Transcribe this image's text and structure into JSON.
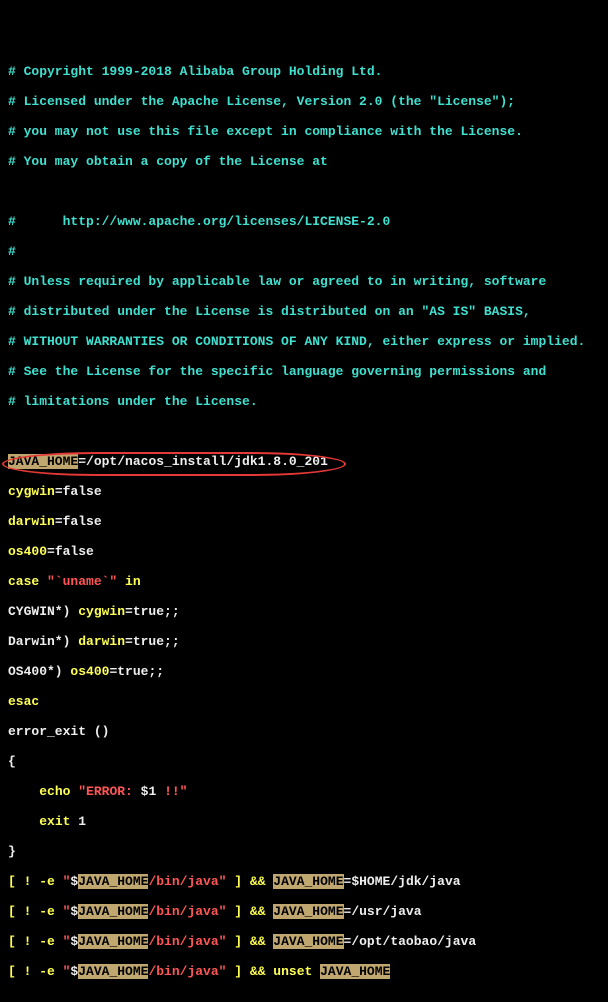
{
  "license": {
    "l1": "# Copyright 1999-2018 Alibaba Group Holding Ltd.",
    "l2": "# Licensed under the Apache License, Version 2.0 (the \"License\");",
    "l3": "# you may not use this file except in compliance with the License.",
    "l4": "# You may obtain a copy of the License at",
    "l5": "#      http://www.apache.org/licenses/LICENSE-2.0",
    "l6": "#",
    "l7": "# Unless required by applicable law or agreed to in writing, software",
    "l8": "# distributed under the License is distributed on an \"AS IS\" BASIS,",
    "l9": "# WITHOUT WARRANTIES OR CONDITIONS OF ANY KIND, either express or implied.",
    "l10": "# See the License for the specific language governing permissions and",
    "l11": "# limitations under the License."
  },
  "java_home": {
    "var": "JAVA_HOME",
    "eq": "=",
    "val": "/opt/nacos_install/jdk1.8.0_201"
  },
  "flags": {
    "cygwin": {
      "name": "cygwin",
      "eq": "=false"
    },
    "darwin": {
      "name": "darwin",
      "eq": "=false"
    },
    "os400": {
      "name": "os400",
      "eq": "=false"
    }
  },
  "case": {
    "kw_case": "case ",
    "expr": "\"`uname`\"",
    "kw_in": " in",
    "l1a": "CYGWIN*) ",
    "l1b": "cygwin",
    "l1c": "=true",
    "l1d": ";;",
    "l2a": "Darwin*) ",
    "l2b": "darwin",
    "l2c": "=true",
    "l2d": ";;",
    "l3a": "OS400*) ",
    "l3b": "os400",
    "l3c": "=true",
    "l3d": ";;",
    "esac": "esac"
  },
  "fn": {
    "name": "error_exit ",
    "paren": "()",
    "open": "{",
    "echo": "echo ",
    "msg1": "\"ERROR: ",
    "msg2": "$1",
    "msg3": " !!\"",
    "exit": "exit ",
    "one": "1",
    "close": "}"
  },
  "checks": {
    "prefix": "[ ! -e ",
    "q": "\"",
    "dollar": "$",
    "var": "JAVA_HOME",
    "path": "/bin/java",
    "mid": " ] && ",
    "assign1": "=",
    "home": "$HOME",
    "rhs1": "/jdk/java",
    "rhs2": "=/usr/java",
    "rhs3": "=/opt/taobao/java",
    "unset": "unset "
  }
}
